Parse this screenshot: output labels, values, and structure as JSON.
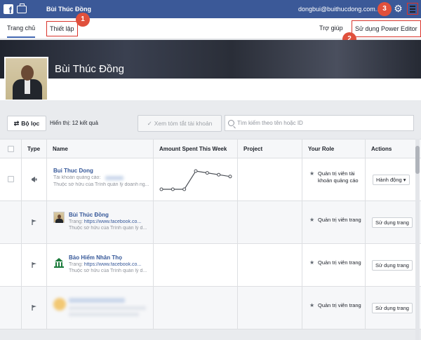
{
  "topbar": {
    "title": "Bùi Thúc Đồng",
    "email": "dongbui@buithucdong.com..."
  },
  "subnav": {
    "home_tab": "Trang chủ",
    "settings_tab": "Thiết lập",
    "help": "Trợ giúp",
    "power_editor": "Sử dụng Power Editor"
  },
  "badges": [
    "1",
    "2",
    "3"
  ],
  "profile": {
    "name": "Bùi Thúc Đồng"
  },
  "toolbar": {
    "filter_label": "Bộ lọc",
    "showing": "Hiển thị: 12 kết quả",
    "summary_btn": "Xem tóm tắt tài khoản",
    "search_placeholder": "Tìm kiếm theo tên hoặc ID"
  },
  "table": {
    "headers": [
      "Type",
      "Name",
      "Amount Spent This Week",
      "Project",
      "Your Role",
      "Actions"
    ],
    "rows": [
      {
        "name": "Bui Thuc Dong",
        "sub1": "Tài khoản quảng cáo:",
        "sub2": "Thuộc sở hữu của Trình quản lý doanh ng...",
        "role": "Quản trị viên tài khoản quảng cáo",
        "action": "Hành động ▾",
        "spend_trend": [
          0,
          0,
          0,
          1,
          0.9,
          0.8,
          0.7
        ]
      },
      {
        "name": "Bùi Thúc Đồng",
        "sub1_prefix": "Trang: ",
        "sub1_link": "https://www.facebook.co...",
        "sub2": "Thuộc sở hữu của Trình quản lý d...",
        "role": "Quản trị viên trang",
        "action": "Sử dụng trang"
      },
      {
        "name": "Bảo Hiểm Nhân Thọ",
        "sub1_prefix": "Trang: ",
        "sub1_link": "https://www.facebook.co...",
        "sub2": "Thuộc sở hữu của Trình quản lý d...",
        "role": "Quản trị viên trang",
        "action": "Sử dụng trang"
      },
      {
        "name": "",
        "role": "Quản trị viên trang",
        "action": "Sử dụng trang"
      }
    ]
  },
  "colors": {
    "topbar": "#3b5998",
    "highlight": "#d9342b",
    "badge": "#e0503c",
    "link": "#365899"
  }
}
